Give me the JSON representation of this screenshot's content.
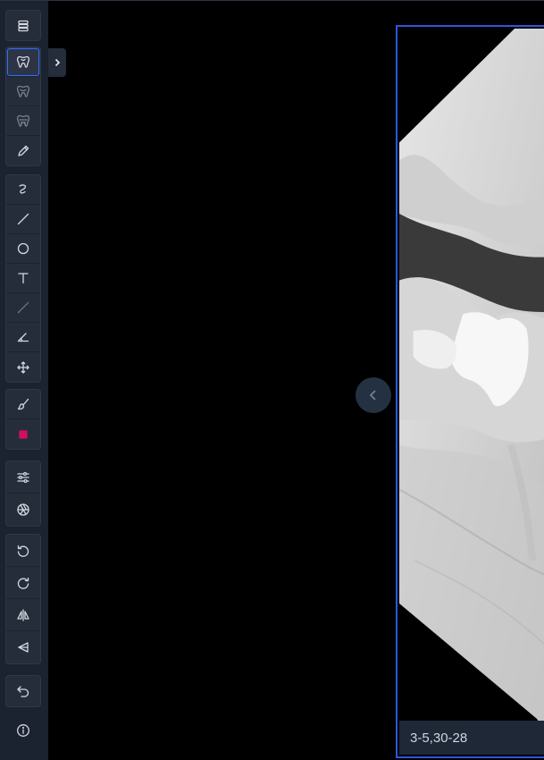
{
  "sidebar": {
    "groups": [
      {
        "items": [
          {
            "icon": "layers-icon",
            "name": "tool-layers"
          }
        ]
      },
      {
        "items": [
          {
            "icon": "tooth-icon",
            "name": "tool-tooth-select",
            "active": true
          },
          {
            "icon": "tooth-outline-icon",
            "name": "tool-tooth-outline"
          },
          {
            "icon": "tooth-roots-icon",
            "name": "tool-tooth-roots"
          },
          {
            "icon": "pencil-icon",
            "name": "tool-pencil"
          }
        ]
      },
      {
        "items": [
          {
            "icon": "freehand-icon",
            "name": "tool-freehand"
          },
          {
            "icon": "line-icon",
            "name": "tool-line"
          },
          {
            "icon": "circle-icon",
            "name": "tool-circle"
          },
          {
            "icon": "text-icon",
            "name": "tool-text"
          },
          {
            "icon": "dashed-line-icon",
            "name": "tool-measure"
          },
          {
            "icon": "angle-icon",
            "name": "tool-angle"
          },
          {
            "icon": "move-icon",
            "name": "tool-move"
          }
        ]
      },
      {
        "items": [
          {
            "icon": "brush-icon",
            "name": "tool-brush"
          },
          {
            "icon": "color-swatch-icon",
            "name": "tool-color",
            "color": "#d0105e"
          }
        ]
      },
      {
        "items": [
          {
            "icon": "sliders-icon",
            "name": "tool-adjust"
          },
          {
            "icon": "aperture-icon",
            "name": "tool-filter"
          }
        ]
      },
      {
        "items": [
          {
            "icon": "rotate-ccw-icon",
            "name": "tool-rotate-left"
          },
          {
            "icon": "rotate-cw-icon",
            "name": "tool-rotate-right"
          },
          {
            "icon": "flip-horizontal-icon",
            "name": "tool-flip-horizontal"
          },
          {
            "icon": "flip-vertical-icon",
            "name": "tool-flip-vertical"
          }
        ]
      },
      {
        "items": [
          {
            "icon": "undo-icon",
            "name": "tool-undo"
          }
        ]
      },
      {
        "items": [
          {
            "icon": "info-icon",
            "name": "tool-info"
          }
        ]
      }
    ]
  },
  "viewer": {
    "image_label": "3-5,30-28"
  },
  "colors": {
    "accent": "#2d56e0",
    "sidebar_bg": "#1b2230",
    "swatch": "#d0105e"
  }
}
